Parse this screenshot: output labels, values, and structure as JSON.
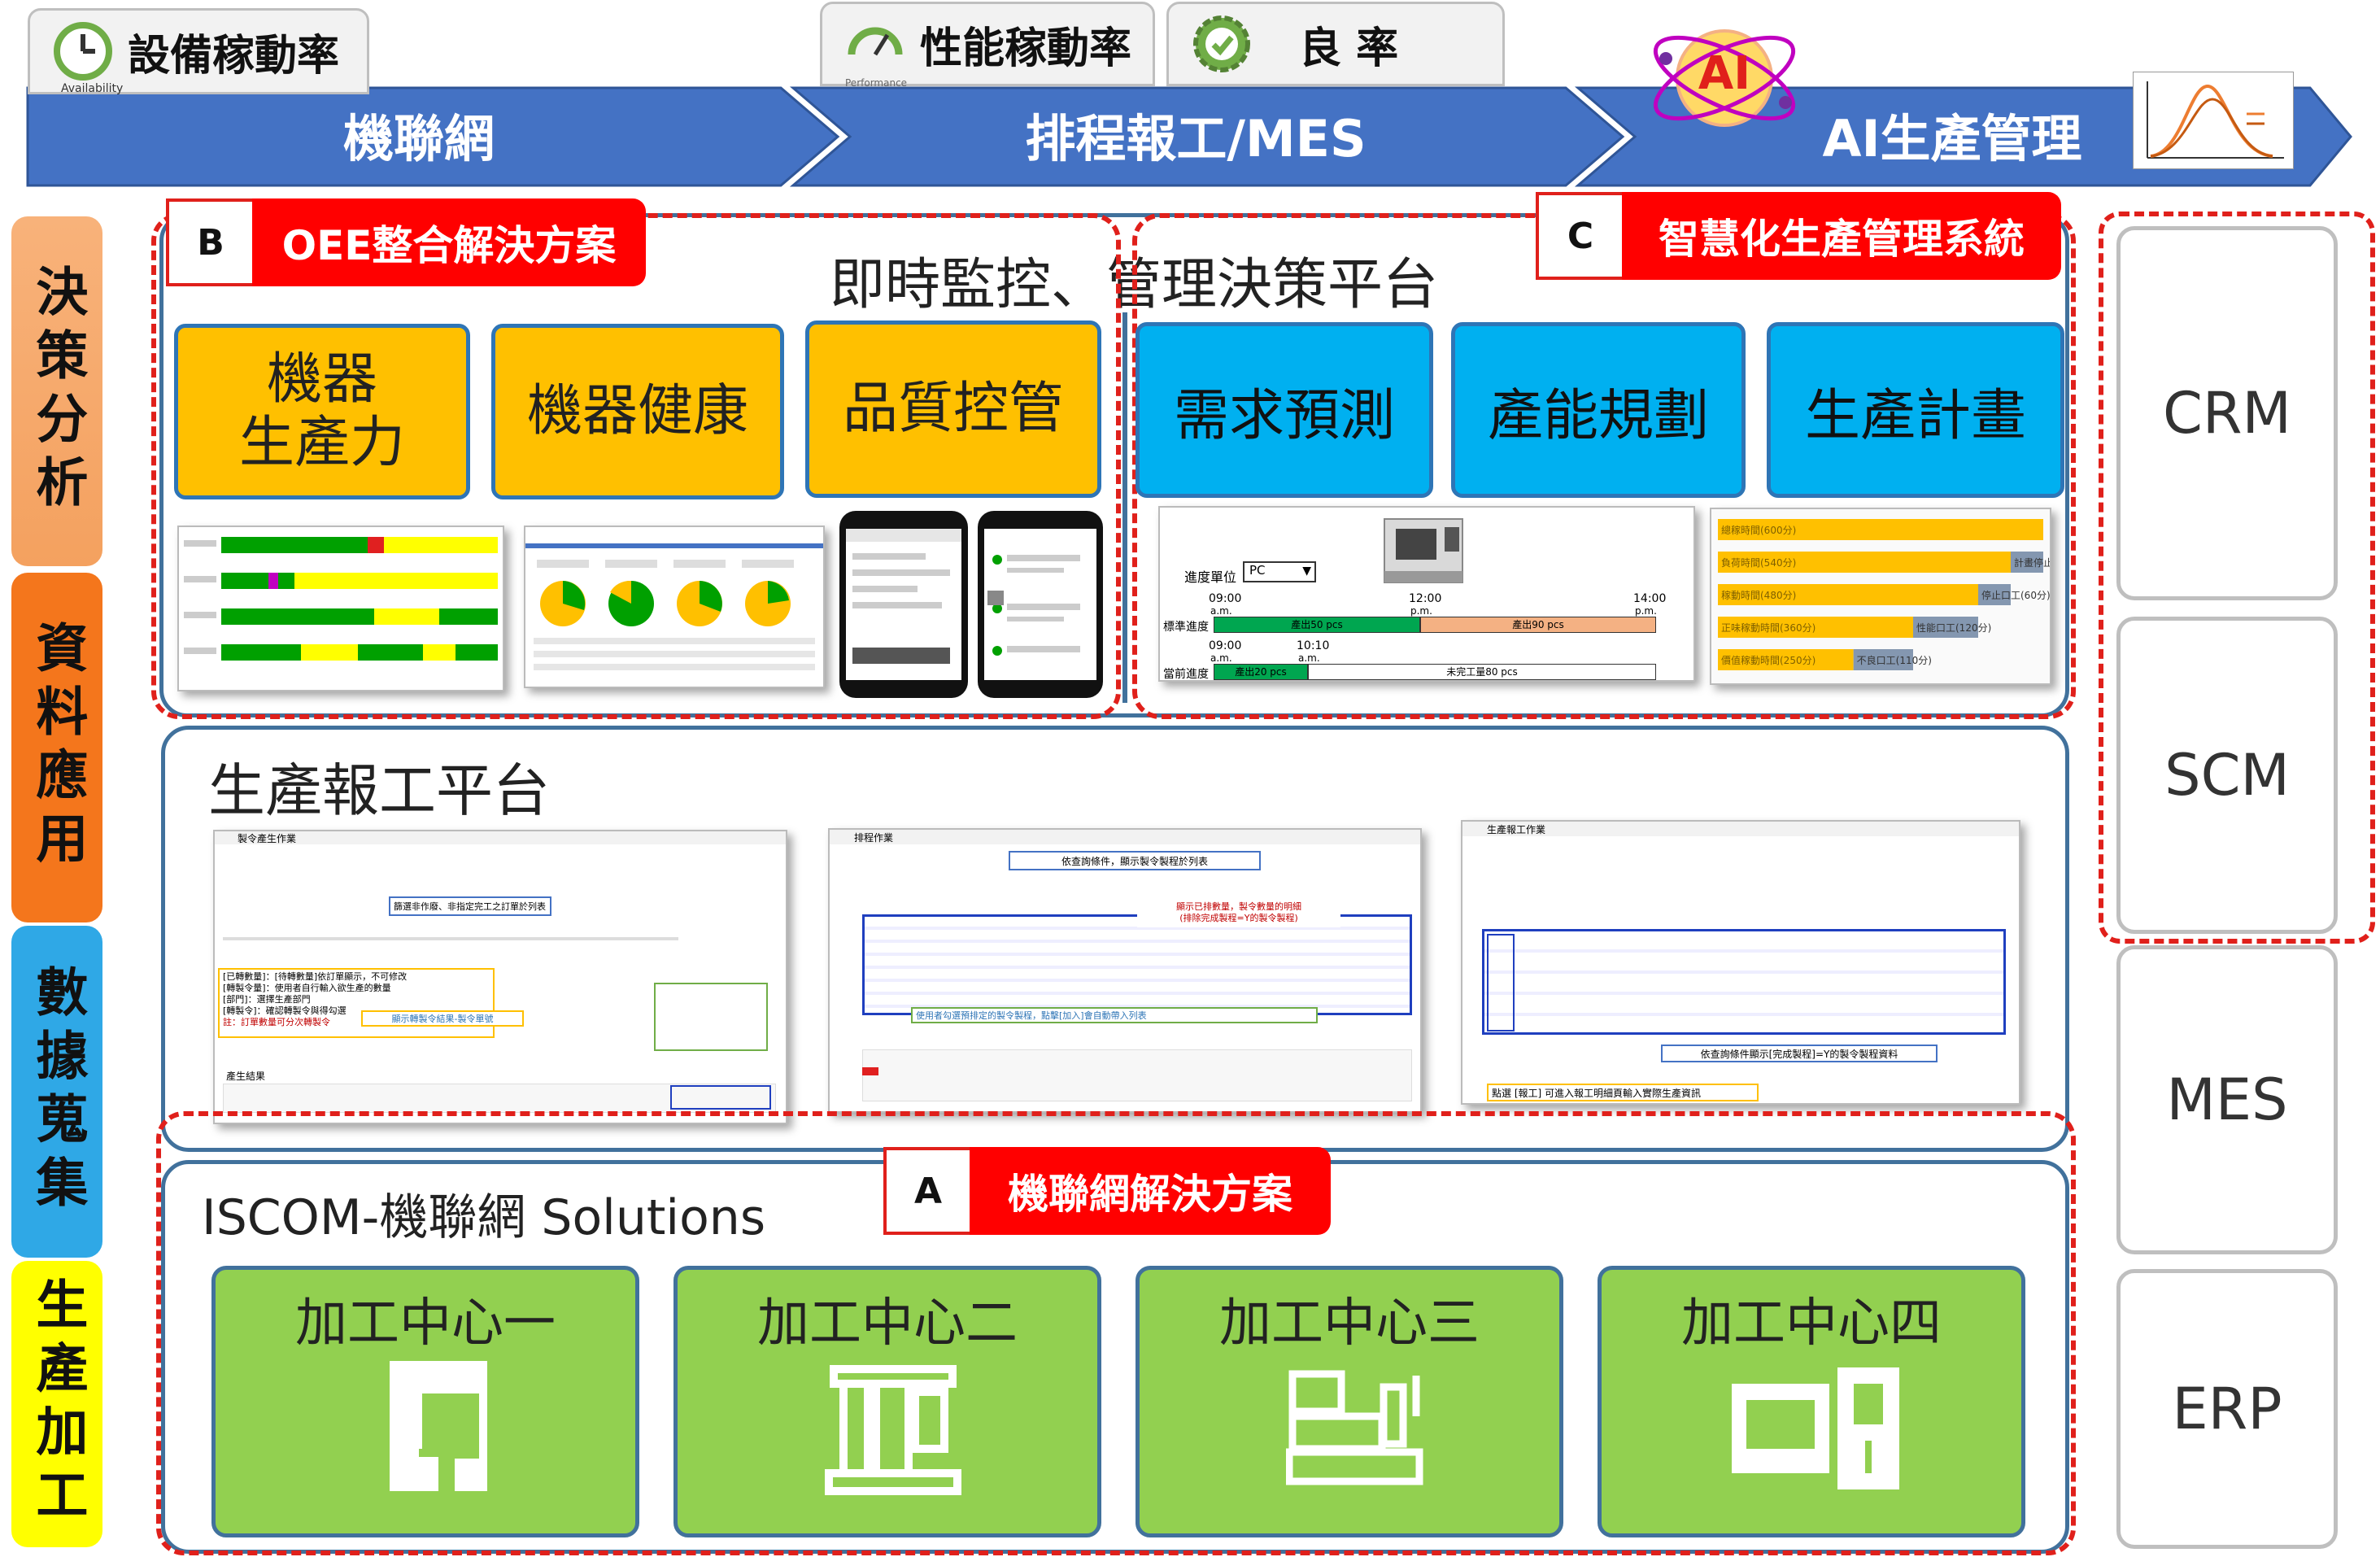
{
  "tabs": {
    "availability": {
      "label": "設備稼動率",
      "sub": "Availability"
    },
    "performance": {
      "label": "性能稼動率",
      "sub": "Performance"
    },
    "quality": {
      "label": "良 率"
    }
  },
  "arrows": [
    "機聯網",
    "排程報工/MES",
    "AI生產管理"
  ],
  "ai_badge": "AI",
  "left_column": [
    "決策分析",
    "資料應用",
    "數據蒐集",
    "生產加工"
  ],
  "right_column": [
    "CRM",
    "SCM",
    "MES",
    "ERP"
  ],
  "section_b": {
    "letter": "B",
    "title": "OEE整合解決方案"
  },
  "section_c": {
    "letter": "C",
    "title": "智慧化生產管理系統"
  },
  "section_a": {
    "letter": "A",
    "title": "機聯網解決方案"
  },
  "monitor_title": "即時監控、管理決策平台",
  "oee_boxes": [
    "機器\n生產力",
    "機器健康",
    "品質控管"
  ],
  "smart_boxes": [
    "需求預測",
    "產能規劃",
    "生產計畫"
  ],
  "report_title": "生產報工平台",
  "iscom_title": "ISCOM-機聯網 Solutions",
  "machines": [
    "加工中心一",
    "加工中心二",
    "加工中心三",
    "加工中心四"
  ],
  "progress_shot": {
    "unit_label": "進度單位",
    "unit_value": "PC",
    "row1_label": "標準進度",
    "row1_start": "09:00",
    "row1_start_ap": "a.m.",
    "row1_mid": "12:00",
    "row1_mid_ap": "p.m.",
    "row1_end": "14:00",
    "row1_end_ap": "p.m.",
    "row1_seg1": "產出50 pcs",
    "row1_seg2": "產出90 pcs",
    "row2_label": "當前進度",
    "row2_start": "09:00",
    "row2_start_ap": "a.m.",
    "row2_mid": "10:10",
    "row2_mid_ap": "a.m.",
    "row2_seg1": "產出20 pcs",
    "row2_seg2": "未完工量80 pcs"
  },
  "bar_shot": [
    {
      "label": "總稼時間(600分)",
      "value": 600
    },
    {
      "label": "負荷時間(540分)",
      "value": 540,
      "note": "計畫停止(60分)"
    },
    {
      "label": "稼動時間(480分)",
      "value": 480,
      "note": "停止口工(60分)"
    },
    {
      "label": "正味稼動時間(360分)",
      "value": 360,
      "note": "性能口工(120分)"
    },
    {
      "label": "價值稼動時間(250分)",
      "value": 250,
      "note": "不良口工(110分)"
    }
  ],
  "report_shots": {
    "s1": {
      "title": "製令產生作業",
      "hint": "篩選非作廢、非指定完工之訂單於列表",
      "note1": "[已轉數量]：[待轉數量]依訂單顯示，不可修改",
      "note2": "[轉製令量]：使用者自行輸入欲生產的數量",
      "note3": "[部門]：選擇生產部門",
      "note4": "[轉製令]：確認轉製令與得勾選",
      "note5": "註：訂單數量可分次轉製令",
      "note6": "顯示轉製令結果-製令單號",
      "result": "產生結果"
    },
    "s2": {
      "title": "排程作業",
      "hint": "依查詢條件，顯示製令製程於列表",
      "note1": "顯示已排數量，製令數量的明細",
      "note2": "(排除完成製程=Y的製令製程)",
      "note3": "使用者勾選預排定的製令製程，點擊[加入]會自動帶入列表"
    },
    "s3": {
      "title": "生產報工作業",
      "hint": "依查詢條件顯示[完成製程]=Y的製令製程資料",
      "note": "點選 [報工] 可進入報工明細頁輸入實際生產資訊"
    }
  },
  "colors": {
    "arrow": "#4472c4",
    "red": "#ff0000",
    "orange": "#ffc000",
    "blue": "#00b0f0",
    "green": "#92d050"
  }
}
